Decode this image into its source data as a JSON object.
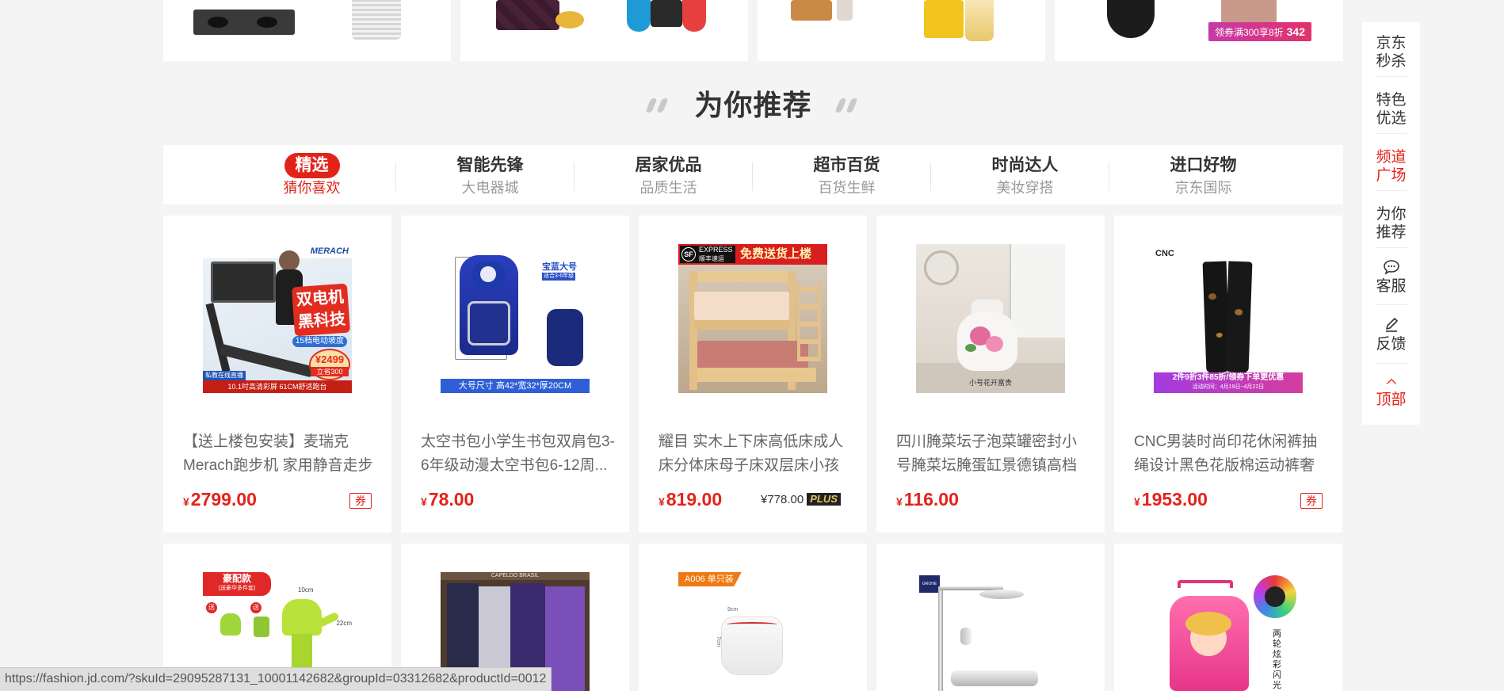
{
  "top_strip": {
    "promo_price_tag": {
      "text": "领券满300享8折",
      "price": "342"
    }
  },
  "section": {
    "title": "为你推荐"
  },
  "tabs": [
    {
      "title": "精选",
      "subtitle": "猜你喜欢",
      "active": true
    },
    {
      "title": "智能先锋",
      "subtitle": "大电器城",
      "active": false
    },
    {
      "title": "居家优品",
      "subtitle": "品质生活",
      "active": false
    },
    {
      "title": "超市百货",
      "subtitle": "百货生鲜",
      "active": false
    },
    {
      "title": "时尚达人",
      "subtitle": "美妆穿搭",
      "active": false
    },
    {
      "title": "进口好物",
      "subtitle": "京东国际",
      "active": false
    }
  ],
  "products": [
    {
      "name": "【送上楼包安装】麦瑞克Merach跑步机 家用静音走步折叠...",
      "currency": "¥",
      "price": "2799.00",
      "coupon": "券",
      "image_text": {
        "brand": "MERACH",
        "headline1": "双电机",
        "headline2": "黑科技",
        "slope": "15档电动坡度",
        "badge_price": "¥2499",
        "badge_save": "立省300",
        "live": "私教在线直播",
        "screen": "10.1吋高清彩屏 61CM舒适跑台"
      }
    },
    {
      "name": "太空书包小学生书包双肩包3-6年级动漫太空书包6-12周...",
      "currency": "¥",
      "price": "78.00",
      "image_text": {
        "size_tag": "宝蓝大号",
        "grade": "适合3-6年级",
        "dims": "大号尺寸  高42*宽32*厚20CM"
      }
    },
    {
      "name": "耀目 实木上下床高低床成人床分体床母子床双层床小孩床...",
      "currency": "¥",
      "price": "819.00",
      "plus_price": "¥778.00",
      "plus_label": "PLUS",
      "image_text": {
        "sf": "SF",
        "express": "EXPRESS",
        "express_cn": "顺丰速运",
        "delivery": "免费送货上楼"
      }
    },
    {
      "name": "四川腌菜坛子泡菜罐密封小号腌菜坛腌蛋缸景德镇高档陶...",
      "currency": "¥",
      "price": "116.00",
      "image_text": {
        "caption": "小号花开富贵"
      }
    },
    {
      "name": "CNC男装时尚印花休闲裤抽绳设计黑色花版棉运动裤奢侈...",
      "currency": "¥",
      "price": "1953.00",
      "coupon": "券",
      "image_text": {
        "brand": "CNC",
        "promo": "2件9折3件85折/领券下单更优惠",
        "promo_date": "活动时间：4月19日~4月22日"
      }
    },
    {
      "image_text": {
        "tag": "豪配款",
        "tag_sub": "(送豪华多件套)",
        "gift": "送",
        "dim1": "10cm",
        "dim2": "22cm"
      }
    },
    {
      "image_text": {
        "brand": "CAPELDO  BRASIL"
      }
    },
    {
      "image_text": {
        "tag": "A006 单只装",
        "dim1": "9cm",
        "dim2": "7cm"
      }
    },
    {
      "image_text": {
        "brand": "GROHE"
      }
    },
    {
      "image_text": {
        "vertical": "两轮炫彩闪光"
      }
    }
  ],
  "sidenav": [
    {
      "label": "京东秒杀",
      "red": false
    },
    {
      "label": "特色优选",
      "red": false
    },
    {
      "label": "频道广场",
      "red": true
    },
    {
      "label": "为你推荐",
      "red": false
    },
    {
      "label": "客服",
      "icon": "chat-bubble-icon",
      "red": false
    },
    {
      "label": "反馈",
      "icon": "edit-pencil-icon",
      "red": false
    },
    {
      "label": "顶部",
      "icon": "chevron-up-icon",
      "red": true
    }
  ],
  "statusbar": {
    "url": "https://fashion.jd.com/?skuId=29095287131_10001142682&groupId=03312682&productId=0012"
  }
}
